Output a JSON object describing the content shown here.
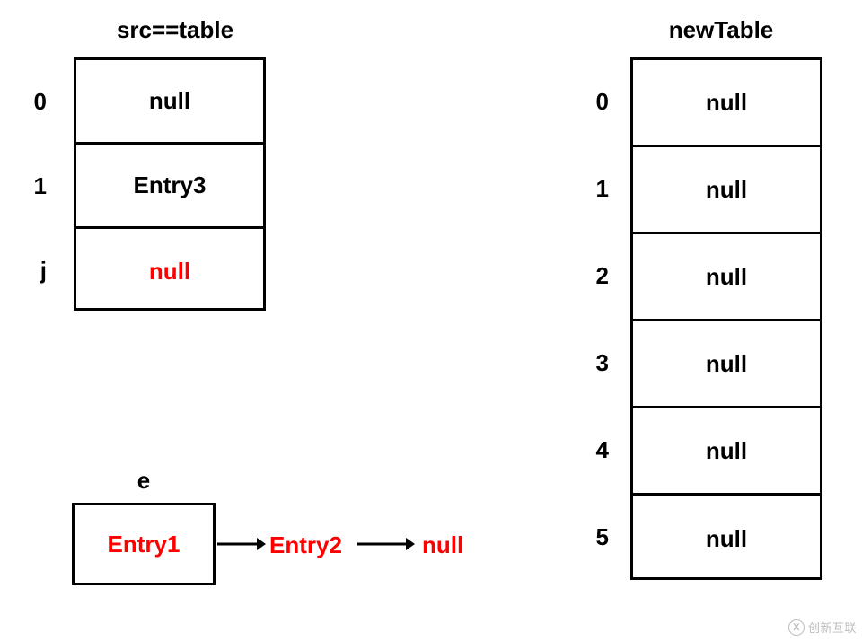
{
  "src_table": {
    "title": "src==table",
    "indices": [
      "0",
      "1",
      "j"
    ],
    "cells": [
      {
        "label": "null",
        "highlight": false
      },
      {
        "label": "Entry3",
        "highlight": false
      },
      {
        "label": "null",
        "highlight": true
      }
    ]
  },
  "new_table": {
    "title": "newTable",
    "indices": [
      "0",
      "1",
      "2",
      "3",
      "4",
      "5"
    ],
    "cells": [
      {
        "label": "null"
      },
      {
        "label": "null"
      },
      {
        "label": "null"
      },
      {
        "label": "null"
      },
      {
        "label": "null"
      },
      {
        "label": "null"
      }
    ]
  },
  "e_node": {
    "title": "e",
    "box_label": "Entry1",
    "next1": "Entry2",
    "next2": "null"
  },
  "watermark": "创新互联"
}
